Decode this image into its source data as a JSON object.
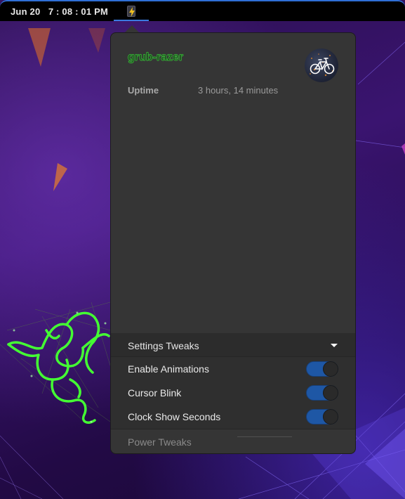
{
  "topbar": {
    "clock": "Jun 20   7 : 08 : 01 PM"
  },
  "menu": {
    "hostname": "grub-razer",
    "uptime_label": "Uptime",
    "uptime_value": "3 hours, 14 minutes",
    "settings_section": {
      "label": "Settings Tweaks",
      "items": [
        {
          "label": "Enable Animations",
          "enabled": true
        },
        {
          "label": "Cursor Blink",
          "enabled": true
        },
        {
          "label": "Clock Show Seconds",
          "enabled": true
        }
      ]
    },
    "power_section": {
      "label": "Power Tweaks"
    }
  },
  "colors": {
    "accent": "#2f6fd6",
    "toggle_on": "#1e57a5",
    "hostname_green": "#4cff4c",
    "razer_green": "#44ff33"
  },
  "icons": {
    "battery": "battery-charging-icon",
    "avatar": "bicycle-avatar",
    "expander": "triangle-down-icon"
  }
}
